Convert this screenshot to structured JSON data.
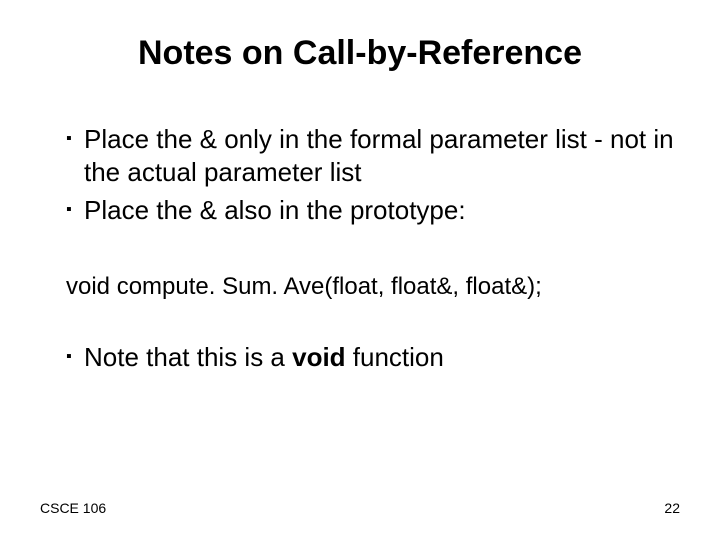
{
  "title": "Notes on Call-by-Reference",
  "bullets": {
    "b1": "Place the & only in the formal parameter list - not in the actual parameter list",
    "b2": "Place the & also in the prototype:",
    "b3_pre": "Note that this is a ",
    "b3_bold": "void",
    "b3_post": " function"
  },
  "code": "void compute. Sum. Ave(float, float&, float&);",
  "footer": {
    "left": "CSCE 106",
    "right": "22"
  },
  "marker": "▪"
}
